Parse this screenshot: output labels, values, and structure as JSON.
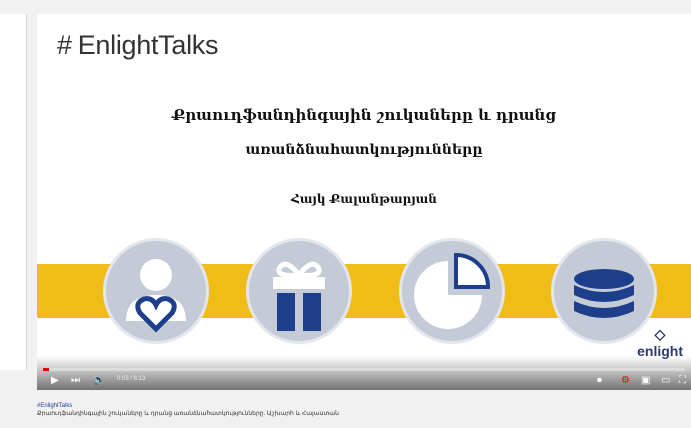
{
  "channel": {
    "hashtag": "#",
    "name": "EnlightTalks"
  },
  "slide": {
    "title_line1": "Քրաուդֆանդինգային շուկաները և դրանց",
    "title_line2": "առանձնահատկությունները",
    "author": "Հայկ Քալանթարյան",
    "watermark": "enlight"
  },
  "icons": [
    "user-heart-icon",
    "gift-icon",
    "pie-chart-icon",
    "database-icon"
  ],
  "player": {
    "time": "0:03 / 6:13",
    "progress": 0.01,
    "accent_color": "#f0bc18",
    "progress_color": "#ff0000"
  },
  "caption": {
    "hashtag": "#EnlightTalks",
    "description": "Քրաուդֆանդինգային շուկաները և դրանց առանձնահատկությունները. Աշխարհ և Հայաստան"
  }
}
